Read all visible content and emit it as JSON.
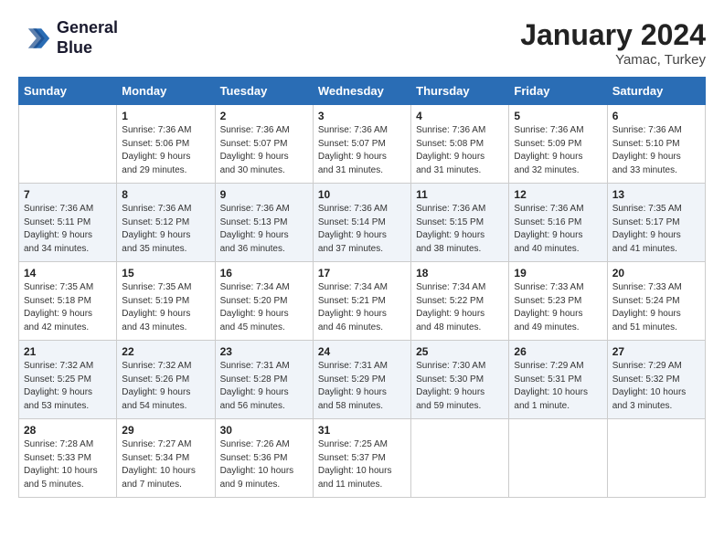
{
  "header": {
    "logo_line1": "General",
    "logo_line2": "Blue",
    "month": "January 2024",
    "location": "Yamac, Turkey"
  },
  "weekdays": [
    "Sunday",
    "Monday",
    "Tuesday",
    "Wednesday",
    "Thursday",
    "Friday",
    "Saturday"
  ],
  "weeks": [
    [
      {
        "day": "",
        "info": ""
      },
      {
        "day": "1",
        "info": "Sunrise: 7:36 AM\nSunset: 5:06 PM\nDaylight: 9 hours\nand 29 minutes."
      },
      {
        "day": "2",
        "info": "Sunrise: 7:36 AM\nSunset: 5:07 PM\nDaylight: 9 hours\nand 30 minutes."
      },
      {
        "day": "3",
        "info": "Sunrise: 7:36 AM\nSunset: 5:07 PM\nDaylight: 9 hours\nand 31 minutes."
      },
      {
        "day": "4",
        "info": "Sunrise: 7:36 AM\nSunset: 5:08 PM\nDaylight: 9 hours\nand 31 minutes."
      },
      {
        "day": "5",
        "info": "Sunrise: 7:36 AM\nSunset: 5:09 PM\nDaylight: 9 hours\nand 32 minutes."
      },
      {
        "day": "6",
        "info": "Sunrise: 7:36 AM\nSunset: 5:10 PM\nDaylight: 9 hours\nand 33 minutes."
      }
    ],
    [
      {
        "day": "7",
        "info": "Sunrise: 7:36 AM\nSunset: 5:11 PM\nDaylight: 9 hours\nand 34 minutes."
      },
      {
        "day": "8",
        "info": "Sunrise: 7:36 AM\nSunset: 5:12 PM\nDaylight: 9 hours\nand 35 minutes."
      },
      {
        "day": "9",
        "info": "Sunrise: 7:36 AM\nSunset: 5:13 PM\nDaylight: 9 hours\nand 36 minutes."
      },
      {
        "day": "10",
        "info": "Sunrise: 7:36 AM\nSunset: 5:14 PM\nDaylight: 9 hours\nand 37 minutes."
      },
      {
        "day": "11",
        "info": "Sunrise: 7:36 AM\nSunset: 5:15 PM\nDaylight: 9 hours\nand 38 minutes."
      },
      {
        "day": "12",
        "info": "Sunrise: 7:36 AM\nSunset: 5:16 PM\nDaylight: 9 hours\nand 40 minutes."
      },
      {
        "day": "13",
        "info": "Sunrise: 7:35 AM\nSunset: 5:17 PM\nDaylight: 9 hours\nand 41 minutes."
      }
    ],
    [
      {
        "day": "14",
        "info": "Sunrise: 7:35 AM\nSunset: 5:18 PM\nDaylight: 9 hours\nand 42 minutes."
      },
      {
        "day": "15",
        "info": "Sunrise: 7:35 AM\nSunset: 5:19 PM\nDaylight: 9 hours\nand 43 minutes."
      },
      {
        "day": "16",
        "info": "Sunrise: 7:34 AM\nSunset: 5:20 PM\nDaylight: 9 hours\nand 45 minutes."
      },
      {
        "day": "17",
        "info": "Sunrise: 7:34 AM\nSunset: 5:21 PM\nDaylight: 9 hours\nand 46 minutes."
      },
      {
        "day": "18",
        "info": "Sunrise: 7:34 AM\nSunset: 5:22 PM\nDaylight: 9 hours\nand 48 minutes."
      },
      {
        "day": "19",
        "info": "Sunrise: 7:33 AM\nSunset: 5:23 PM\nDaylight: 9 hours\nand 49 minutes."
      },
      {
        "day": "20",
        "info": "Sunrise: 7:33 AM\nSunset: 5:24 PM\nDaylight: 9 hours\nand 51 minutes."
      }
    ],
    [
      {
        "day": "21",
        "info": "Sunrise: 7:32 AM\nSunset: 5:25 PM\nDaylight: 9 hours\nand 53 minutes."
      },
      {
        "day": "22",
        "info": "Sunrise: 7:32 AM\nSunset: 5:26 PM\nDaylight: 9 hours\nand 54 minutes."
      },
      {
        "day": "23",
        "info": "Sunrise: 7:31 AM\nSunset: 5:28 PM\nDaylight: 9 hours\nand 56 minutes."
      },
      {
        "day": "24",
        "info": "Sunrise: 7:31 AM\nSunset: 5:29 PM\nDaylight: 9 hours\nand 58 minutes."
      },
      {
        "day": "25",
        "info": "Sunrise: 7:30 AM\nSunset: 5:30 PM\nDaylight: 9 hours\nand 59 minutes."
      },
      {
        "day": "26",
        "info": "Sunrise: 7:29 AM\nSunset: 5:31 PM\nDaylight: 10 hours\nand 1 minute."
      },
      {
        "day": "27",
        "info": "Sunrise: 7:29 AM\nSunset: 5:32 PM\nDaylight: 10 hours\nand 3 minutes."
      }
    ],
    [
      {
        "day": "28",
        "info": "Sunrise: 7:28 AM\nSunset: 5:33 PM\nDaylight: 10 hours\nand 5 minutes."
      },
      {
        "day": "29",
        "info": "Sunrise: 7:27 AM\nSunset: 5:34 PM\nDaylight: 10 hours\nand 7 minutes."
      },
      {
        "day": "30",
        "info": "Sunrise: 7:26 AM\nSunset: 5:36 PM\nDaylight: 10 hours\nand 9 minutes."
      },
      {
        "day": "31",
        "info": "Sunrise: 7:25 AM\nSunset: 5:37 PM\nDaylight: 10 hours\nand 11 minutes."
      },
      {
        "day": "",
        "info": ""
      },
      {
        "day": "",
        "info": ""
      },
      {
        "day": "",
        "info": ""
      }
    ]
  ]
}
